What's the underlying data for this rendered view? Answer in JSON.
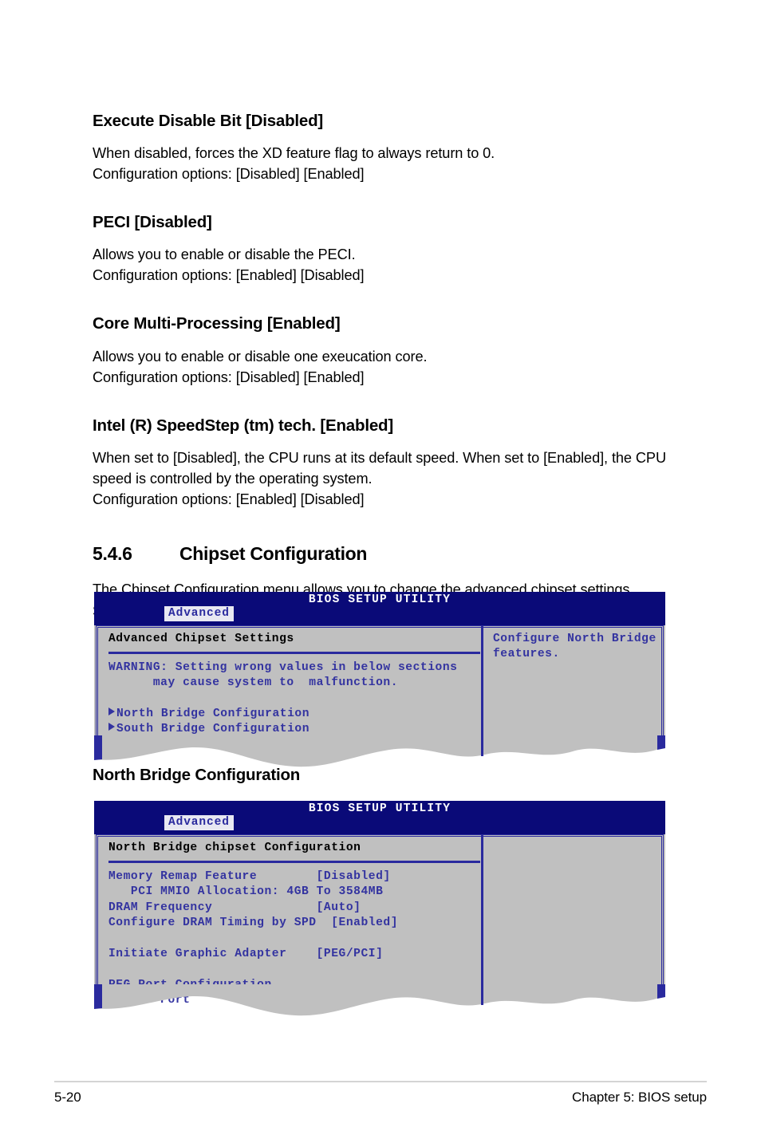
{
  "page": {
    "footer_page_number": "5-20",
    "footer_chapter": "Chapter 5: BIOS setup"
  },
  "content": {
    "entries": [
      {
        "heading": "Execute Disable Bit [Disabled]",
        "description": "When disabled, forces the XD feature flag to always return to 0.",
        "options": "Configuration options: [Disabled] [Enabled]"
      },
      {
        "heading": "PECI [Disabled]",
        "description": "Allows you to enable or disable the PECI.",
        "options": "Configuration options: [Enabled] [Disabled]"
      },
      {
        "heading": "Core Multi-Processing [Enabled]",
        "description": "Allows you to enable or disable one exeucation core.",
        "options": "Configuration options: [Disabled] [Enabled]"
      },
      {
        "heading": "Intel (R) SpeedStep (tm) tech. [Enabled]",
        "description": "When set to [Disabled], the CPU runs at its default speed. When set to [Enabled], the CPU speed is controlled by the operating system.",
        "options": "Configuration options: [Enabled] [Disabled]"
      }
    ],
    "section": {
      "number": "5.4.6",
      "title": "Chipset Configuration",
      "intro": "The Chipset Configuration menu allows you to change the advanced chipset settings. Select an item then press <Enter> to display the sub-menu."
    },
    "figure_heading": "North Bridge Configuration"
  },
  "bios_screen_1": {
    "title": "BIOS SETUP UTILITY",
    "active_tab": "Advanced",
    "section_title": "Advanced Chipset Settings",
    "lines": [
      "WARNING: Setting wrong values in below sections",
      "      may cause system to  malfunction."
    ],
    "menu_items": [
      "North Bridge Configuration",
      "South Bridge Configuration"
    ],
    "help_text": "Configure North Bridge\nfeatures."
  },
  "bios_screen_2": {
    "title": "BIOS SETUP UTILITY",
    "active_tab": "Advanced",
    "section_title": "North Bridge chipset Configuration",
    "settings": [
      "Memory Remap Feature        [Disabled]",
      "   PCI MMIO Allocation: 4GB To 3584MB",
      "DRAM Frequency              [Auto]",
      "Configure DRAM Timing by SPD  [Enabled]",
      "",
      "Initiate Graphic Adapter    [PEG/PCI]",
      "",
      "PEG Port Configuration",
      "   PEG Port                 [Auto]"
    ],
    "help_text": ""
  },
  "colors": {
    "bios_titlebar": "#0a0a78",
    "bios_panel": "#c0c0c0",
    "bios_accent": "#2a2a9e",
    "bios_text": "#3333a0"
  }
}
